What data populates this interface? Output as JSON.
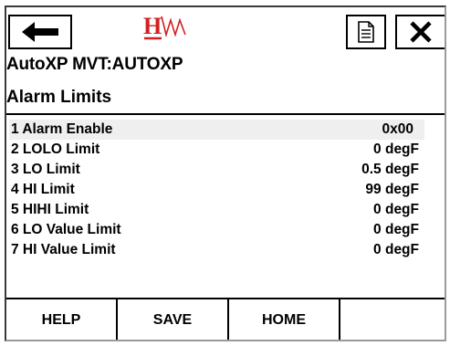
{
  "topbar": {
    "back_icon": "arrow-left-icon",
    "logo_icon": "hw-logo-icon",
    "doc_icon": "document-icon",
    "close_icon": "close-x-icon"
  },
  "device_title": "AutoXP MVT:AUTOXP",
  "section_title": "Alarm Limits",
  "items": [
    {
      "label": "1 Alarm Enable",
      "value": "0x00"
    },
    {
      "label": "2 LOLO Limit",
      "value": "0 degF"
    },
    {
      "label": "3 LO Limit",
      "value": "0.5 degF"
    },
    {
      "label": "4 HI Limit",
      "value": "99 degF"
    },
    {
      "label": "5 HIHI Limit",
      "value": "0 degF"
    },
    {
      "label": "6 LO Value Limit",
      "value": "0 degF"
    },
    {
      "label": "7 HI Value Limit",
      "value": "0 degF"
    }
  ],
  "bottombar": {
    "help_label": "HELP",
    "save_label": "SAVE",
    "home_label": "HOME"
  },
  "colors": {
    "logo_red": "#d31f1f",
    "selected_row": "#efefef"
  }
}
